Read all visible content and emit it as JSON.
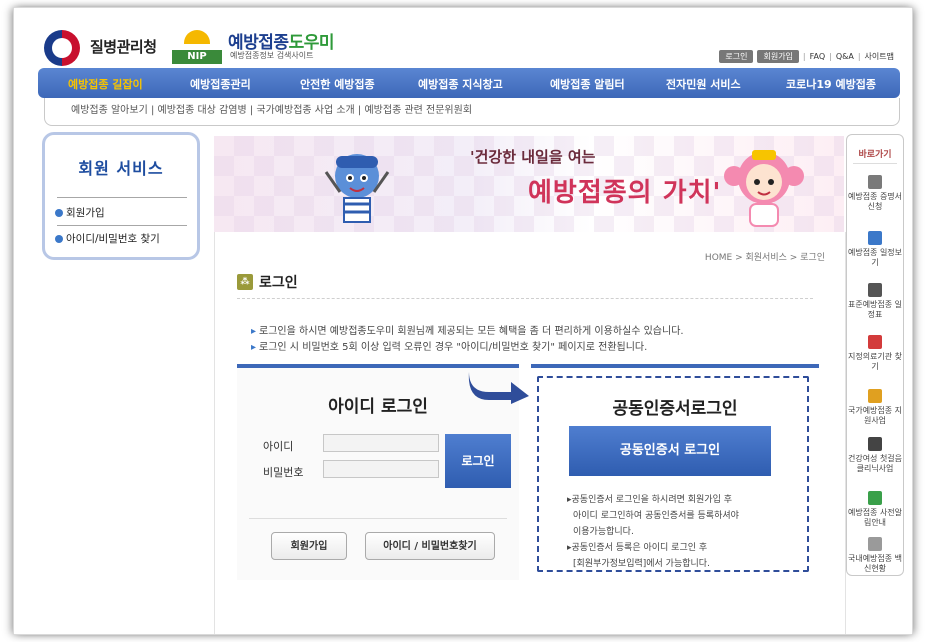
{
  "header": {
    "org_name": "질병관리청",
    "site_title_a": "예방접종",
    "site_title_b": "도우미",
    "site_subtitle": "예방접종정보 검색사이트",
    "nip_label": "NIP",
    "top_links": {
      "login": "로그인",
      "join": "회원가입",
      "faq": "FAQ",
      "qna": "Q&A",
      "sitemap": "사이트맵"
    }
  },
  "gnb": [
    {
      "label": "예방접종 길잡이",
      "active": true
    },
    {
      "label": "예방접종관리",
      "active": false
    },
    {
      "label": "안전한 예방접종",
      "active": false
    },
    {
      "label": "예방접종 지식창고",
      "active": false
    },
    {
      "label": "예방접종 알림터",
      "active": false
    },
    {
      "label": "전자민원 서비스",
      "active": false
    },
    {
      "label": "코로나19 예방접종",
      "active": false
    }
  ],
  "subnav": "예방접종 알아보기 | 예방접종 대상 감염병 | 국가예방접종 사업 소개 | 예방접종 관련 전문위원회",
  "sidebar": {
    "title": "회원 서비스",
    "items": [
      {
        "label": "회원가입"
      },
      {
        "label": "아이디/비밀번호 찾기"
      }
    ]
  },
  "banner": {
    "line1": "'건강한 내일을 여는",
    "line2": "예방접종의 가치'"
  },
  "content": {
    "breadcrumb": "HOME > 회원서비스 > 로그인",
    "title": "로그인",
    "notices": [
      "로그인을 하시면 예방접종도우미 회원님께 제공되는 모든 혜택을 좀 더 편리하게 이용하실수 있습니다.",
      "로그인 시 비밀번호 5회 이상 입력 오류인 경우 \"아이디/비밀번호 찾기\" 페이지로 전환됩니다."
    ],
    "id_login": {
      "title": "아이디 로그인",
      "id_label": "아이디",
      "pw_label": "비밀번호",
      "login_button": "로그인",
      "join_button": "회원가입",
      "find_button": "아이디 / 비밀번호찾기"
    },
    "cert_login": {
      "title": "공동인증서로그인",
      "button": "공동인증서 로그인",
      "notes": [
        "▸공동인증서 로그인을 하시려면 회원가입 후",
        "아이디 로그인하여 공동인증서를 등록하셔야",
        "이용가능합니다.",
        "▸공동인증서 등록은 아이디 로그인 후",
        "[회원부가정보입력]에서 가능합니다."
      ]
    }
  },
  "quick_menu": {
    "title": "바로가기",
    "items": [
      {
        "label": "예방접종 증명서 신청",
        "icon": "printer-icon",
        "color": "#7a7a7a"
      },
      {
        "label": "예방접종 일정보기",
        "icon": "calendar-icon",
        "color": "#3b78c9"
      },
      {
        "label": "표준예방접종 일정표",
        "icon": "pen-icon",
        "color": "#555555"
      },
      {
        "label": "지정의료기관 찾기",
        "icon": "hospital-icon",
        "color": "#d33b3b"
      },
      {
        "label": "국가예방접종 지원사업",
        "icon": "document-icon",
        "color": "#e0a020"
      },
      {
        "label": "건강여성 첫걸음 클리닉사업",
        "icon": "medical-kit-icon",
        "color": "#444444"
      },
      {
        "label": "예방접종 사전알림안내",
        "icon": "speaker-icon",
        "color": "#3aa04a"
      },
      {
        "label": "국내예방접종 백신현황",
        "icon": "vaccine-icon",
        "color": "#9a9a9a"
      }
    ]
  },
  "colors": {
    "primary": "#3d68b8",
    "active_menu": "#f7c400",
    "banner_accent": "#d0345a"
  }
}
